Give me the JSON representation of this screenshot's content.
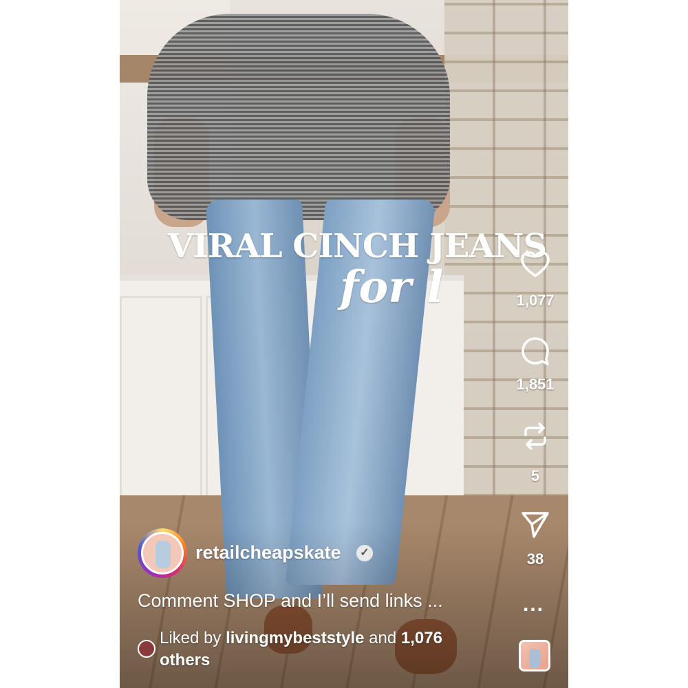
{
  "overlay": {
    "headline_line1": "VIRAL CINCH JEANS",
    "headline_line2": "for l"
  },
  "actions": {
    "like_count": "1,077",
    "comment_count": "1,851",
    "repost_count": "5",
    "share_count": "38",
    "more_label": "..."
  },
  "author": {
    "username": "retailcheapskate",
    "verified_mark": "✓"
  },
  "post": {
    "caption": "Comment SHOP and I’ll send links ...",
    "liked_by_prefix": "Liked by ",
    "liked_by_user": "livingmybeststyle",
    "liked_by_middle": " and ",
    "liked_by_count": "1,076",
    "liked_by_suffix": " others"
  },
  "icons": {
    "like": "heart-icon",
    "comment": "comment-icon",
    "repost": "repost-icon",
    "share": "send-icon",
    "more": "more-icon"
  },
  "colors": {
    "overlay_text": "#ffffff",
    "story_ring": [
      "#feda75",
      "#fa7e1e",
      "#d62976",
      "#962fbf",
      "#4f5bd5"
    ]
  }
}
